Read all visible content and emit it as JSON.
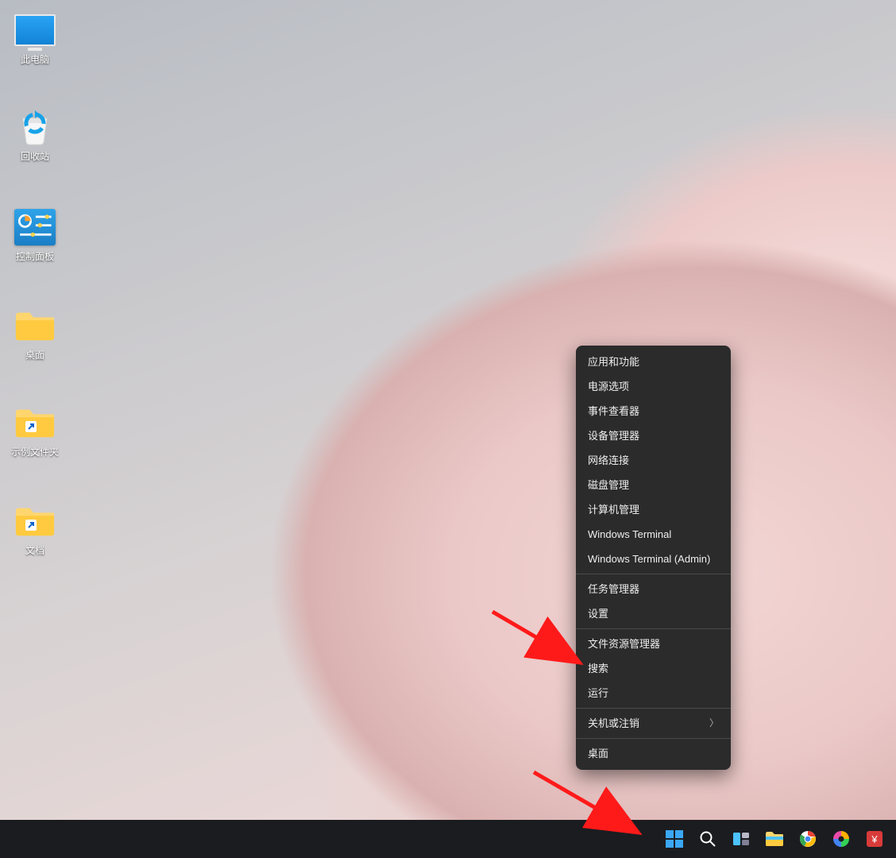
{
  "desktop_icons": [
    {
      "label": "此电脑"
    },
    {
      "label": "回收站"
    },
    {
      "label": "控制面板"
    },
    {
      "label": "桌面"
    },
    {
      "label": "示例文件夹"
    },
    {
      "label": "文档"
    }
  ],
  "winx_menu": {
    "groups": [
      [
        "应用和功能",
        "电源选项",
        "事件查看器",
        "设备管理器",
        "网络连接",
        "磁盘管理",
        "计算机管理",
        "Windows Terminal",
        "Windows Terminal (Admin)"
      ],
      [
        "任务管理器",
        "设置"
      ],
      [
        "文件资源管理器",
        "搜索",
        "运行"
      ],
      [
        {
          "label": "关机或注销",
          "submenu": true
        }
      ],
      [
        "桌面"
      ]
    ]
  },
  "taskbar": {
    "items": [
      "start",
      "search",
      "task-view",
      "file-explorer",
      "chrome",
      "browser-color",
      "app-red"
    ]
  }
}
